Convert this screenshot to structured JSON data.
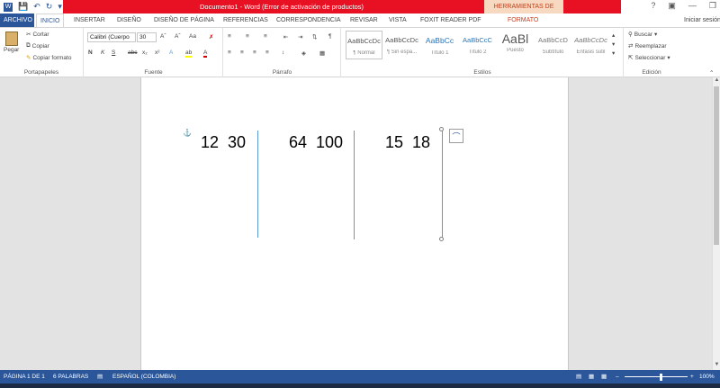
{
  "title": {
    "document": "Documento1 - Word (Error de activación de productos)",
    "drawing_tools": "HERRAMIENTAS DE DIBUJO",
    "help": "?",
    "signin": "Iniciar sesión"
  },
  "tabs": [
    "ARCHIVO",
    "INICIO",
    "INSERTAR",
    "DISEÑO",
    "DISEÑO DE PÁGINA",
    "REFERENCIAS",
    "CORRESPONDENCIA",
    "REVISAR",
    "VISTA",
    "FOXIT READER PDF",
    "FORMATO"
  ],
  "clipboard": {
    "paste": "Pegar",
    "cut": "Cortar",
    "copy": "Copiar",
    "format_painter": "Copiar formato",
    "label": "Portapapeles"
  },
  "font": {
    "name": "Calibri (Cuerpo",
    "size": "30",
    "label": "Fuente"
  },
  "paragraph": {
    "label": "Párrafo"
  },
  "styles": {
    "label": "Estilos",
    "items": [
      {
        "sample": "AaBbCcDc",
        "name": "¶ Normal"
      },
      {
        "sample": "AaBbCcDc",
        "name": "¶ Sin espa..."
      },
      {
        "sample": "AaBbCc",
        "name": "Título 1"
      },
      {
        "sample": "AaBbCcC",
        "name": "Título 2"
      },
      {
        "sample": "AaBl",
        "name": "Puesto"
      },
      {
        "sample": "AaBbCcD",
        "name": "Subtítulo"
      },
      {
        "sample": "AaBbCcDc",
        "name": "Énfasis sutil"
      }
    ]
  },
  "editing": {
    "find": "Buscar",
    "replace": "Reemplazar",
    "select": "Seleccionar",
    "label": "Edición"
  },
  "document": {
    "groups": [
      "12  30",
      "64  100",
      "15  18"
    ]
  },
  "status": {
    "page": "PÁGINA 1 DE 1",
    "words": "6 PALABRAS",
    "language": "ESPAÑOL (COLOMBIA)",
    "zoom": "100%"
  }
}
